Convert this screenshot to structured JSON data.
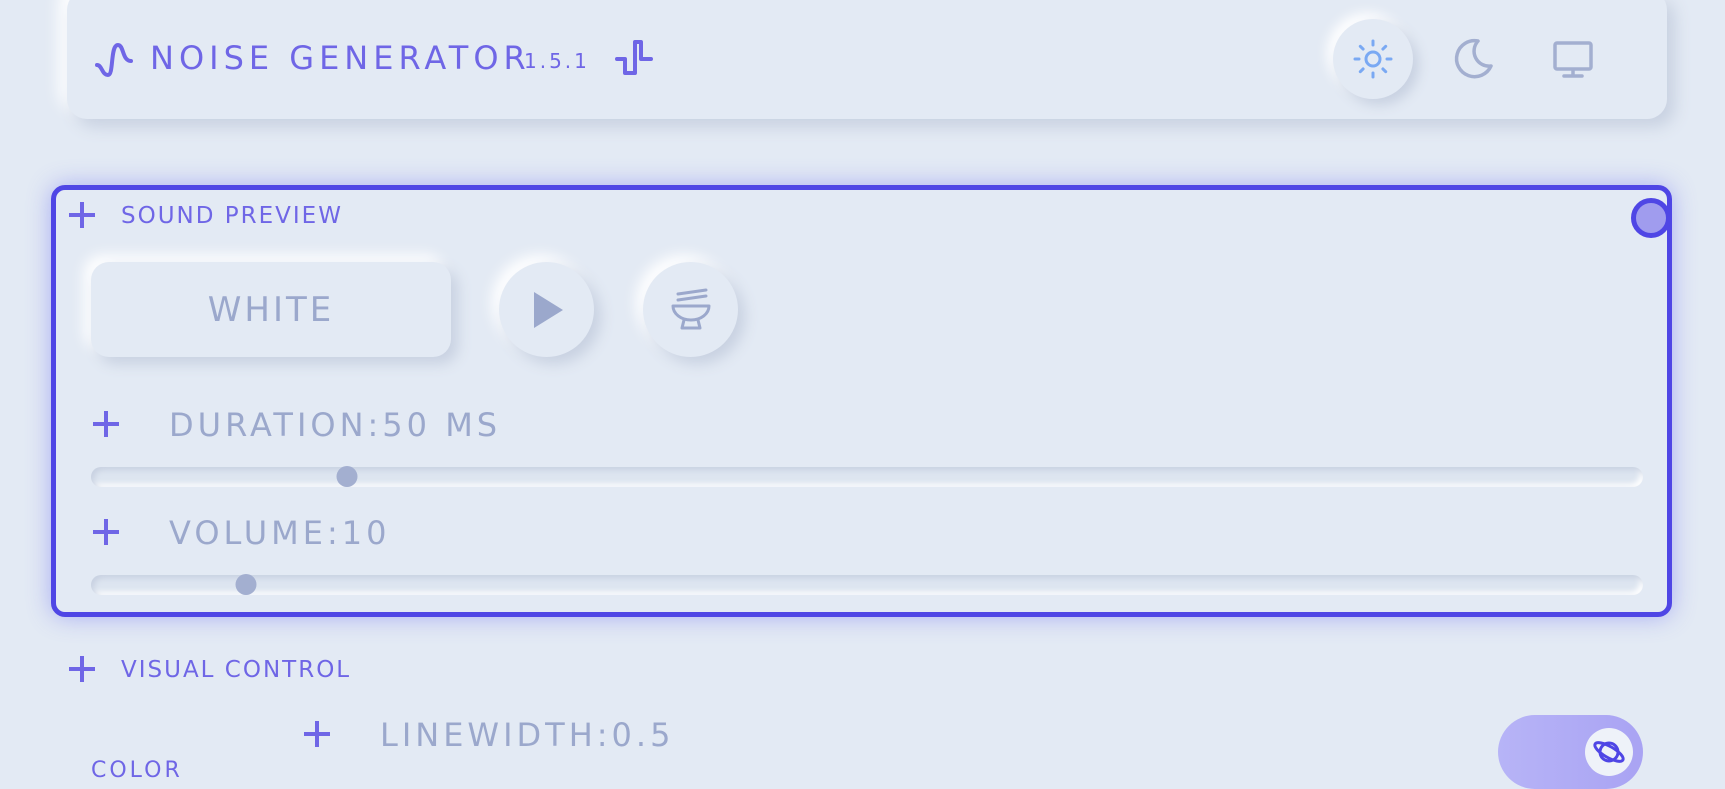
{
  "header": {
    "title": "NOISE GENERATOR",
    "version": "1.5.1",
    "theme_buttons": [
      {
        "name": "light",
        "icon": "sun-icon",
        "active": true
      },
      {
        "name": "dark",
        "icon": "moon-icon",
        "active": false
      },
      {
        "name": "system",
        "icon": "monitor-icon",
        "active": false
      }
    ]
  },
  "sound_preview": {
    "section_label": "SOUND PREVIEW",
    "noise_type": "WHITE",
    "play_icon": "play-icon",
    "bowl_icon": "bowl-icon",
    "duration": {
      "label": "DURATION:50 MS",
      "fraction": 0.165
    },
    "volume": {
      "label": "VOLUME:10",
      "fraction": 0.1
    }
  },
  "visual_control": {
    "section_label": "VISUAL CONTROL",
    "linewidth_label": "LINEWIDTH:0.5",
    "color_label": "COLOR",
    "toggle_icon": "planet-icon",
    "toggle_on": true
  },
  "colors": {
    "accent": "#6f66e6",
    "panel_border": "#4f46e5",
    "muted_text": "#9ba8cc",
    "background": "#e3eaf4"
  }
}
